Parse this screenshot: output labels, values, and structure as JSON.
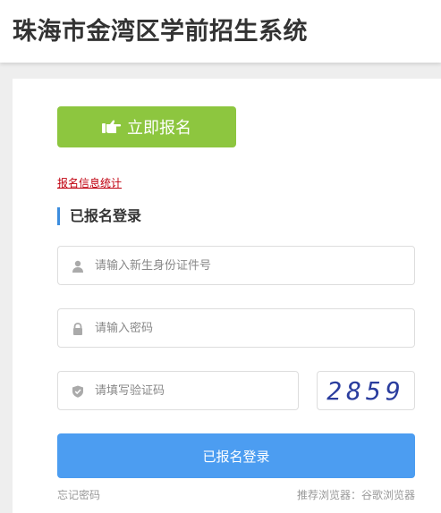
{
  "header": {
    "title": "珠海市金湾区学前招生系统"
  },
  "signup": {
    "label": "立即报名",
    "icon": "hand-pointing-right-icon"
  },
  "stats_link": {
    "label": "报名信息统计"
  },
  "login": {
    "heading": "已报名登录",
    "id_field": {
      "placeholder": "请输入新生身份证件号",
      "value": "",
      "icon": "user-icon"
    },
    "password_field": {
      "placeholder": "请输入密码",
      "value": "",
      "icon": "lock-icon"
    },
    "captcha_field": {
      "placeholder": "请填写验证码",
      "value": "",
      "icon": "shield-icon"
    },
    "captcha_code": "2859",
    "submit_label": "已报名登录",
    "forgot_label": "忘记密码",
    "browser_tip": "推荐浏览器：谷歌浏览器"
  },
  "colors": {
    "signup_green": "#8dc63f",
    "login_blue": "#4c9df1",
    "heading_accent": "#3c8dde",
    "link_red": "#c0000f"
  }
}
